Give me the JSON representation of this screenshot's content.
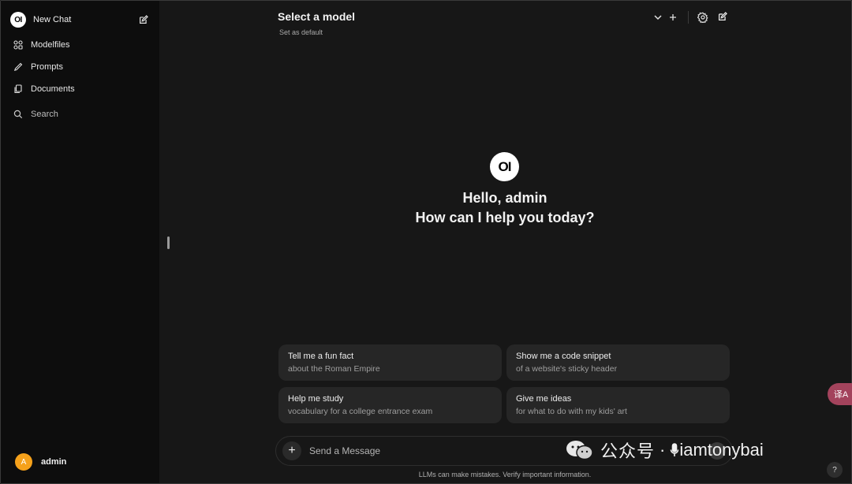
{
  "sidebar": {
    "logo_text": "OI",
    "new_chat_label": "New Chat",
    "items": [
      {
        "label": "Modelfiles",
        "icon": "modelfiles-icon"
      },
      {
        "label": "Prompts",
        "icon": "pencil-icon"
      },
      {
        "label": "Documents",
        "icon": "documents-icon"
      }
    ],
    "search_label": "Search",
    "user": {
      "avatar_letter": "A",
      "name": "admin"
    }
  },
  "header": {
    "model_title": "Select a model",
    "set_default": "Set as default"
  },
  "main": {
    "logo_text": "OI",
    "greeting_line1": "Hello, admin",
    "greeting_line2": "How can I help you today?",
    "suggestions": [
      {
        "title": "Tell me a fun fact",
        "subtitle": "about the Roman Empire"
      },
      {
        "title": "Show me a code snippet",
        "subtitle": "of a website's sticky header"
      },
      {
        "title": "Help me study",
        "subtitle": "vocabulary for a college entrance exam"
      },
      {
        "title": "Give me ideas",
        "subtitle": "for what to do with my kids' art"
      }
    ]
  },
  "input": {
    "placeholder": "Send a Message",
    "disclaimer": "LLMs can make mistakes. Verify important information."
  },
  "watermark": {
    "text": "公众号",
    "separator": "·",
    "handle": "iamtonybai"
  },
  "floating": {
    "translate_label": "译A",
    "help_label": "?"
  },
  "colors": {
    "sidebar_bg": "#0d0d0d",
    "main_bg": "#171717",
    "card_bg": "#262626",
    "avatar": "#f5a11b",
    "float_btn": "#a3435c"
  }
}
